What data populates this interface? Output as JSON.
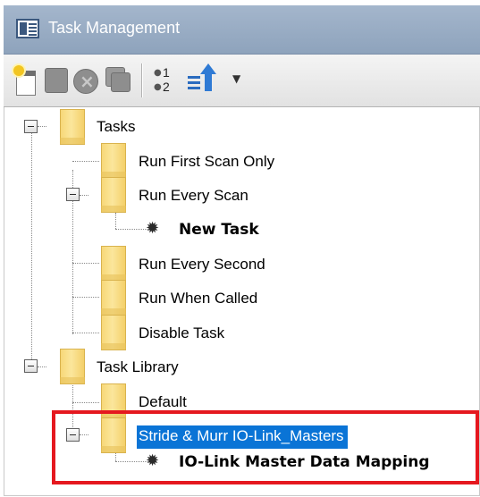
{
  "window": {
    "title": "Task Management",
    "icon": "window-icon"
  },
  "toolbar": {
    "buttons": [
      {
        "name": "new-task-icon"
      },
      {
        "name": "stop-icon"
      },
      {
        "name": "delete-icon"
      },
      {
        "name": "copy-icon"
      },
      {
        "name": "execution-order-icon",
        "line1": "1",
        "line2": "2"
      },
      {
        "name": "sort-icon"
      },
      {
        "name": "dropdown-arrow-icon",
        "glyph": "▼"
      }
    ]
  },
  "tree": {
    "tasks": {
      "label": "Tasks",
      "children": [
        {
          "label": "Run First Scan Only"
        },
        {
          "label": "Run Every Scan",
          "children": [
            {
              "label": "New Task"
            }
          ]
        },
        {
          "label": "Run Every Second"
        },
        {
          "label": "Run When Called"
        },
        {
          "label": "Disable Task"
        }
      ]
    },
    "library": {
      "label": "Task Library",
      "children": [
        {
          "label": "Default"
        },
        {
          "label": "Stride & Murr IO-Link_Masters",
          "selected": true,
          "children": [
            {
              "label": "IO-Link Master Data Mapping"
            }
          ]
        }
      ]
    }
  },
  "colors": {
    "titlebar": "#9aaec6",
    "selection": "#0a74d6",
    "highlight_border": "#e5181f",
    "folder": "#f7d878"
  }
}
